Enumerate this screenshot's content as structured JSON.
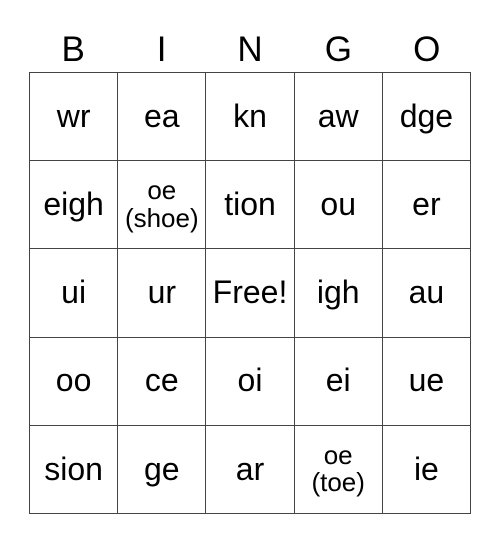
{
  "header": [
    "B",
    "I",
    "N",
    "G",
    "O"
  ],
  "cells": [
    "wr",
    "ea",
    "kn",
    "aw",
    "dge",
    "eigh",
    "oe\n(shoe)",
    "tion",
    "ou",
    "er",
    "ui",
    "ur",
    "Free!",
    "igh",
    "au",
    "oo",
    "ce",
    "oi",
    "ei",
    "ue",
    "sion",
    "ge",
    "ar",
    "oe\n(toe)",
    "ie"
  ]
}
